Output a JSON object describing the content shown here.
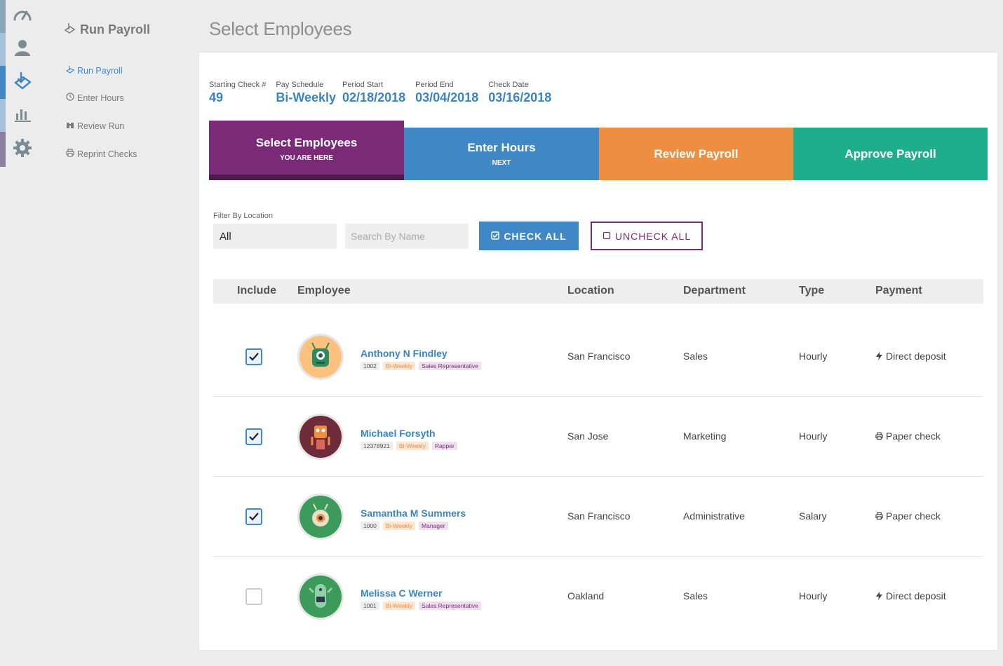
{
  "rail": {
    "items": [
      {
        "icon": "dashboard-icon",
        "stripe": "#8aa5b8"
      },
      {
        "icon": "users-icon",
        "stripe": "#a7c0d9"
      },
      {
        "icon": "payroll-icon",
        "stripe": "#3f88c5"
      },
      {
        "icon": "reports-icon",
        "stripe": "#a7c0d9"
      },
      {
        "icon": "settings-icon",
        "stripe": "#8f7f9e"
      }
    ]
  },
  "subnav": {
    "title": "Run Payroll",
    "links": [
      {
        "label": "Run Payroll",
        "icon": "hand-icon",
        "active": true
      },
      {
        "label": "Enter Hours",
        "icon": "clock-icon",
        "active": false
      },
      {
        "label": "Review Run",
        "icon": "binoculars-icon",
        "active": false
      },
      {
        "label": "Reprint Checks",
        "icon": "print-icon",
        "active": false
      }
    ]
  },
  "page": {
    "title": "Select Employees"
  },
  "summary": {
    "starting_check_label": "Starting Check #",
    "starting_check_value": "49",
    "pay_schedule_label": "Pay Schedule",
    "pay_schedule_value": "Bi-Weekly",
    "period_start_label": "Period Start",
    "period_start_value": "02/18/2018",
    "period_end_label": "Period End",
    "period_end_value": "03/04/2018",
    "check_date_label": "Check Date",
    "check_date_value": "03/16/2018"
  },
  "steps": [
    {
      "name": "Select Employees",
      "sub": "YOU ARE HERE",
      "color": "#7b2a77"
    },
    {
      "name": "Enter Hours",
      "sub": "NEXT",
      "color": "#3f88c5"
    },
    {
      "name": "Review Payroll",
      "sub": "",
      "color": "#ee8e40"
    },
    {
      "name": "Approve Payroll",
      "sub": "",
      "color": "#1fae8c"
    }
  ],
  "filters": {
    "location_label": "Filter By Location",
    "location_value": "All",
    "search_placeholder": "Search By Name",
    "check_all_label": "CHECK ALL",
    "uncheck_all_label": "UNCHECK ALL"
  },
  "table": {
    "headers": {
      "include": "Include",
      "employee": "Employee",
      "location": "Location",
      "department": "Department",
      "type": "Type",
      "payment": "Payment"
    },
    "rows": [
      {
        "checked": true,
        "name": "Anthony N Findley",
        "id": "1002",
        "schedule": "Bi-Weekly",
        "role": "Sales Representative",
        "location": "San Francisco",
        "department": "Sales",
        "type": "Hourly",
        "payment": "Direct deposit",
        "payment_icon": "bolt-icon"
      },
      {
        "checked": true,
        "name": "Michael Forsyth",
        "id": "12378921",
        "schedule": "Bi-Weekly",
        "role": "Rapper",
        "location": "San Jose",
        "department": "Marketing",
        "type": "Hourly",
        "payment": "Paper check",
        "payment_icon": "print-icon"
      },
      {
        "checked": true,
        "name": "Samantha M Summers",
        "id": "1000",
        "schedule": "Bi-Weekly",
        "role": "Manager",
        "location": "San Francisco",
        "department": "Administrative",
        "type": "Salary",
        "payment": "Paper check",
        "payment_icon": "print-icon"
      },
      {
        "checked": false,
        "name": "Melissa C Werner",
        "id": "1001",
        "schedule": "Bi-Weekly",
        "role": "Sales Representative",
        "location": "Oakland",
        "department": "Sales",
        "type": "Hourly",
        "payment": "Direct deposit",
        "payment_icon": "bolt-icon"
      }
    ]
  }
}
